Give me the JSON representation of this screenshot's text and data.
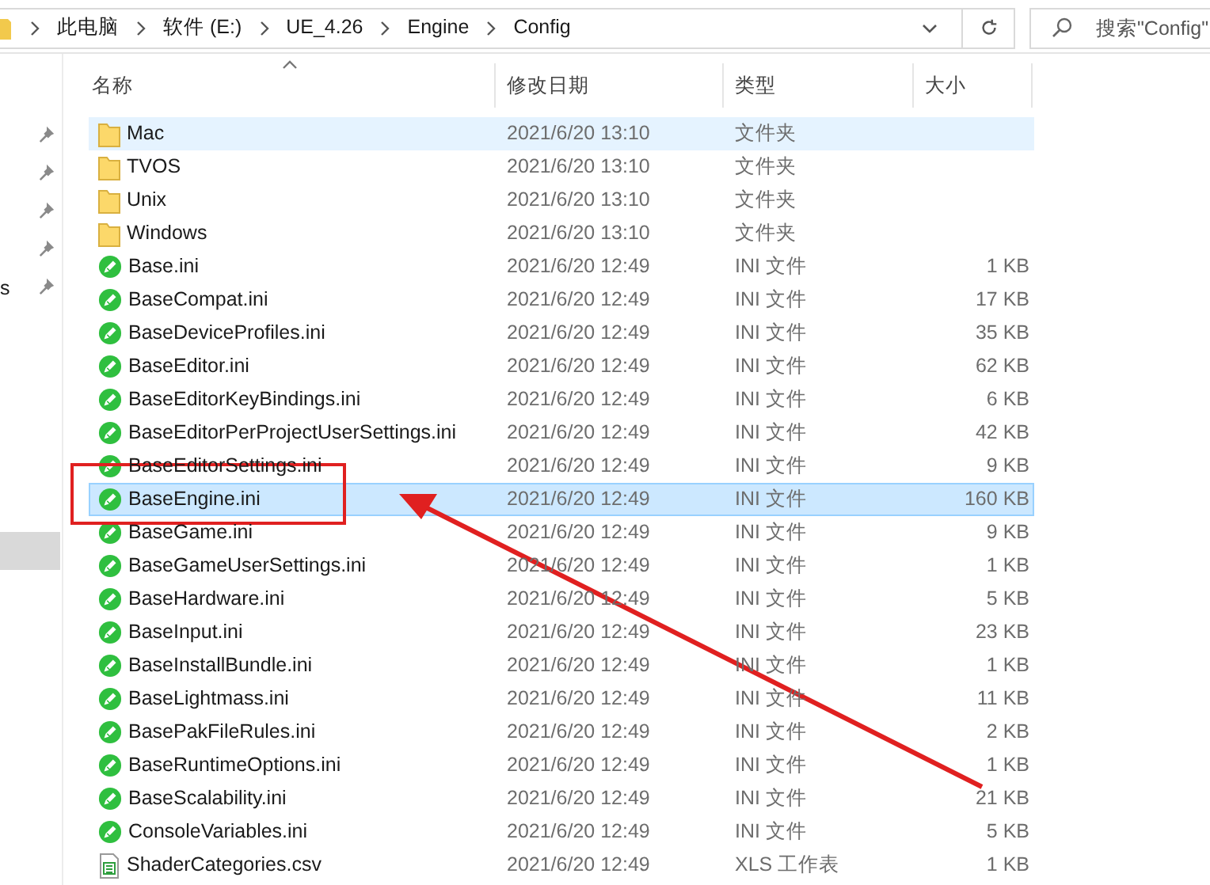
{
  "address_bar": {
    "path": [
      "此电脑",
      "软件 (E:)",
      "UE_4.26",
      "Engine",
      "Config"
    ]
  },
  "search": {
    "placeholder": "搜索\"Config\""
  },
  "nav_pane": {
    "items": [
      {
        "pinned": true
      },
      {
        "pinned": true
      },
      {
        "pinned": true
      },
      {
        "pinned": true
      },
      {
        "label": "s",
        "pinned": true
      }
    ]
  },
  "table": {
    "columns": [
      "名称",
      "修改日期",
      "类型",
      "大小"
    ],
    "rows": [
      {
        "kind": "folder",
        "name": "Mac",
        "modified": "2021/6/20 13:10",
        "type": "文件夹",
        "hovered": true,
        "selected": false
      },
      {
        "kind": "folder",
        "name": "TVOS",
        "modified": "2021/6/20 13:10",
        "type": "文件夹",
        "hovered": false,
        "selected": false
      },
      {
        "kind": "folder",
        "name": "Unix",
        "modified": "2021/6/20 13:10",
        "type": "文件夹",
        "hovered": false,
        "selected": false
      },
      {
        "kind": "folder",
        "name": "Windows",
        "modified": "2021/6/20 13:10",
        "type": "文件夹",
        "hovered": false,
        "selected": false
      },
      {
        "kind": "ini",
        "name": "Base.ini",
        "modified": "2021/6/20 12:49",
        "type": "INI 文件",
        "size": "1 KB",
        "hovered": false,
        "selected": false
      },
      {
        "kind": "ini",
        "name": "BaseCompat.ini",
        "modified": "2021/6/20 12:49",
        "type": "INI 文件",
        "size": "17 KB",
        "hovered": false,
        "selected": false
      },
      {
        "kind": "ini",
        "name": "BaseDeviceProfiles.ini",
        "modified": "2021/6/20 12:49",
        "type": "INI 文件",
        "size": "35 KB",
        "hovered": false,
        "selected": false
      },
      {
        "kind": "ini",
        "name": "BaseEditor.ini",
        "modified": "2021/6/20 12:49",
        "type": "INI 文件",
        "size": "62 KB",
        "hovered": false,
        "selected": false
      },
      {
        "kind": "ini",
        "name": "BaseEditorKeyBindings.ini",
        "modified": "2021/6/20 12:49",
        "type": "INI 文件",
        "size": "6 KB",
        "hovered": false,
        "selected": false
      },
      {
        "kind": "ini",
        "name": "BaseEditorPerProjectUserSettings.ini",
        "modified": "2021/6/20 12:49",
        "type": "INI 文件",
        "size": "42 KB",
        "hovered": false,
        "selected": false
      },
      {
        "kind": "ini",
        "name": "BaseEditorSettings.ini",
        "modified": "2021/6/20 12:49",
        "type": "INI 文件",
        "size": "9 KB",
        "hovered": false,
        "selected": false
      },
      {
        "kind": "ini",
        "name": "BaseEngine.ini",
        "modified": "2021/6/20 12:49",
        "type": "INI 文件",
        "size": "160 KB",
        "hovered": false,
        "selected": true
      },
      {
        "kind": "ini",
        "name": "BaseGame.ini",
        "modified": "2021/6/20 12:49",
        "type": "INI 文件",
        "size": "9 KB",
        "hovered": false,
        "selected": false
      },
      {
        "kind": "ini",
        "name": "BaseGameUserSettings.ini",
        "modified": "2021/6/20 12:49",
        "type": "INI 文件",
        "size": "1 KB",
        "hovered": false,
        "selected": false
      },
      {
        "kind": "ini",
        "name": "BaseHardware.ini",
        "modified": "2021/6/20 12:49",
        "type": "INI 文件",
        "size": "5 KB",
        "hovered": false,
        "selected": false
      },
      {
        "kind": "ini",
        "name": "BaseInput.ini",
        "modified": "2021/6/20 12:49",
        "type": "INI 文件",
        "size": "23 KB",
        "hovered": false,
        "selected": false
      },
      {
        "kind": "ini",
        "name": "BaseInstallBundle.ini",
        "modified": "2021/6/20 12:49",
        "type": "INI 文件",
        "size": "1 KB",
        "hovered": false,
        "selected": false
      },
      {
        "kind": "ini",
        "name": "BaseLightmass.ini",
        "modified": "2021/6/20 12:49",
        "type": "INI 文件",
        "size": "11 KB",
        "hovered": false,
        "selected": false
      },
      {
        "kind": "ini",
        "name": "BasePakFileRules.ini",
        "modified": "2021/6/20 12:49",
        "type": "INI 文件",
        "size": "2 KB",
        "hovered": false,
        "selected": false
      },
      {
        "kind": "ini",
        "name": "BaseRuntimeOptions.ini",
        "modified": "2021/6/20 12:49",
        "type": "INI 文件",
        "size": "1 KB",
        "hovered": false,
        "selected": false
      },
      {
        "kind": "ini",
        "name": "BaseScalability.ini",
        "modified": "2021/6/20 12:49",
        "type": "INI 文件",
        "size": "21 KB",
        "hovered": false,
        "selected": false
      },
      {
        "kind": "ini",
        "name": "ConsoleVariables.ini",
        "modified": "2021/6/20 12:49",
        "type": "INI 文件",
        "size": "5 KB",
        "hovered": false,
        "selected": false
      },
      {
        "kind": "csv",
        "name": "ShaderCategories.csv",
        "modified": "2021/6/20 12:49",
        "type": "XLS 工作表",
        "size": "1 KB",
        "hovered": false,
        "selected": false
      }
    ]
  }
}
